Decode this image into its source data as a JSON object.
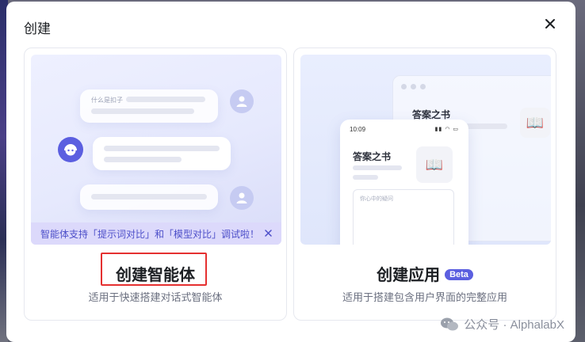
{
  "dialog": {
    "title": "创建",
    "close_icon": "close-icon"
  },
  "cards": {
    "agent": {
      "title": "创建智能体",
      "description": "适用于快速搭建对话式智能体",
      "preview": {
        "question_text": "什么是扣子",
        "tip": "智能体支持「提示词对比」和「模型对比」调试啦！"
      }
    },
    "app": {
      "title": "创建应用",
      "badge": "Beta",
      "description": "适用于搭建包含用户界面的完整应用",
      "preview": {
        "window_app_name": "答案之书",
        "phone_time": "10:09",
        "phone_app_name": "答案之书",
        "input_placeholder": "你心中的疑问"
      }
    }
  },
  "watermark": {
    "text": "公众号 · AlphalabX"
  },
  "colors": {
    "accent": "#5b5fe0",
    "highlight": "#e53030",
    "tip_bg": "#dcd9fb"
  }
}
